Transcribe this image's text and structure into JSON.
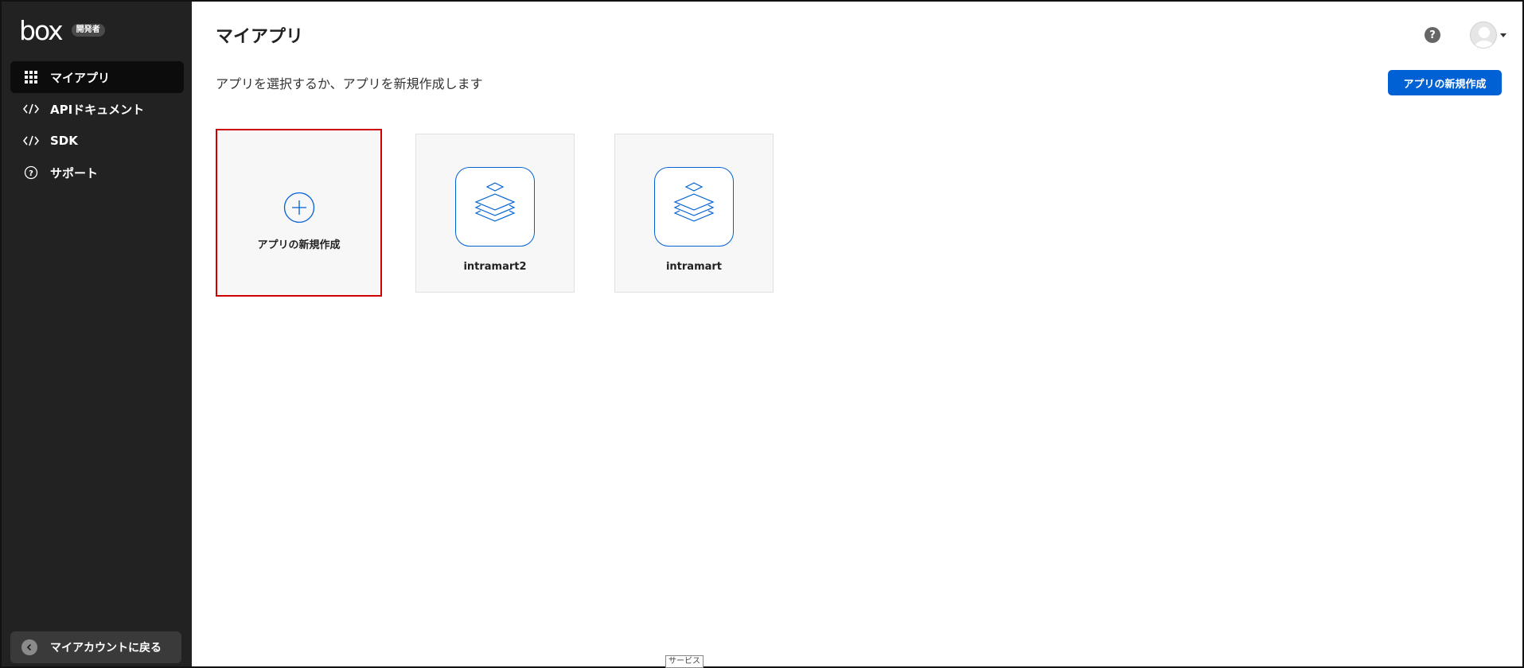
{
  "brand": {
    "logo": "box",
    "badge": "開発者"
  },
  "sidebar": {
    "items": [
      {
        "label": "マイアプリ",
        "icon": "grid-icon",
        "active": true
      },
      {
        "label": "APIドキュメント",
        "icon": "code-icon",
        "active": false
      },
      {
        "label": "SDK",
        "icon": "code-icon",
        "active": false
      },
      {
        "label": "サポート",
        "icon": "help-circle-icon",
        "active": false
      }
    ],
    "back": {
      "label": "マイアカウントに戻る",
      "icon": "chevron-left-icon"
    }
  },
  "header": {
    "title": "マイアプリ",
    "subtitle": "アプリを選択するか、アプリを新規作成します",
    "create_button": "アプリの新規作成",
    "help_glyph": "?"
  },
  "cards": {
    "new_label": "アプリの新規作成",
    "apps": [
      {
        "name": "intramart2",
        "icon": "layers-icon"
      },
      {
        "name": "intramart",
        "icon": "layers-icon"
      }
    ]
  },
  "footer": {
    "service_tag": "サービス"
  },
  "colors": {
    "sidebar_bg": "#222222",
    "accent": "#0061d5",
    "highlight": "#cc0000"
  }
}
